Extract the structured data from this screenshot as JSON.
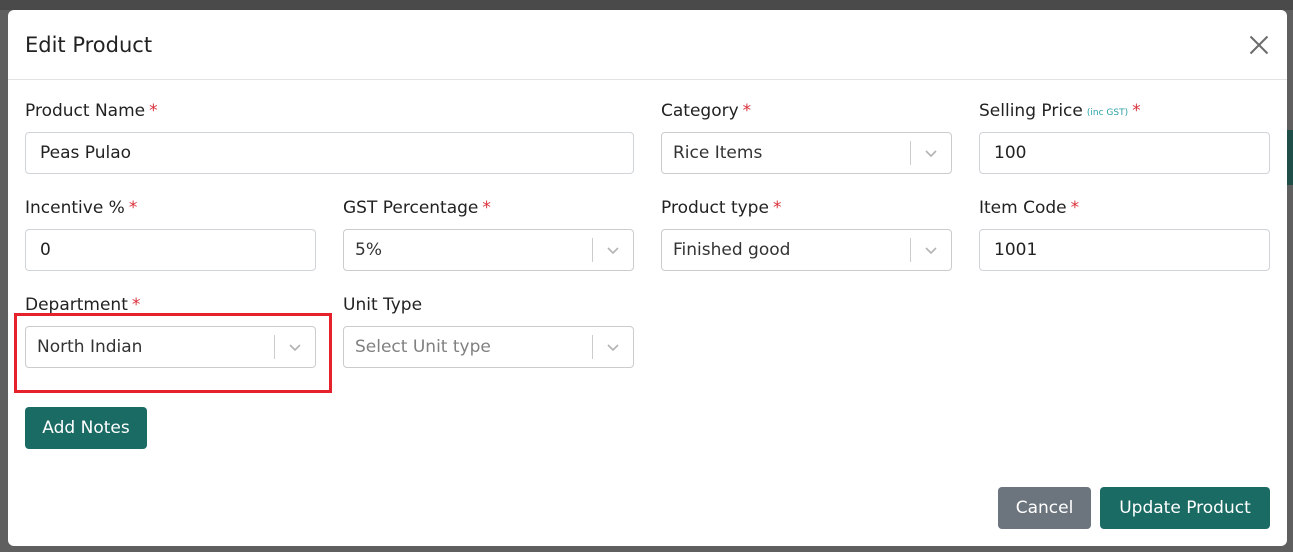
{
  "modal": {
    "title": "Edit Product",
    "close_icon": "close-icon",
    "required_mark": "*"
  },
  "fields": {
    "product_name": {
      "label": "Product Name",
      "value": "Peas Pulao"
    },
    "category": {
      "label": "Category",
      "value": "Rice Items"
    },
    "selling_price": {
      "label": "Selling Price",
      "sublabel": "(inc GST)",
      "value": "100"
    },
    "incentive": {
      "label": "Incentive %",
      "value": "0"
    },
    "gst": {
      "label": "GST Percentage",
      "value": "5%"
    },
    "product_type": {
      "label": "Product type",
      "value": "Finished good"
    },
    "item_code": {
      "label": "Item Code",
      "value": "1001"
    },
    "department": {
      "label": "Department",
      "value": "North Indian"
    },
    "unit_type": {
      "label": "Unit Type",
      "placeholder": "Select Unit type"
    }
  },
  "buttons": {
    "add_notes": "Add Notes",
    "cancel": "Cancel",
    "update": "Update Product"
  },
  "colors": {
    "primary": "#1a6b64",
    "secondary": "#6c757d",
    "required": "#d9313a",
    "highlight": "#e5222c"
  }
}
